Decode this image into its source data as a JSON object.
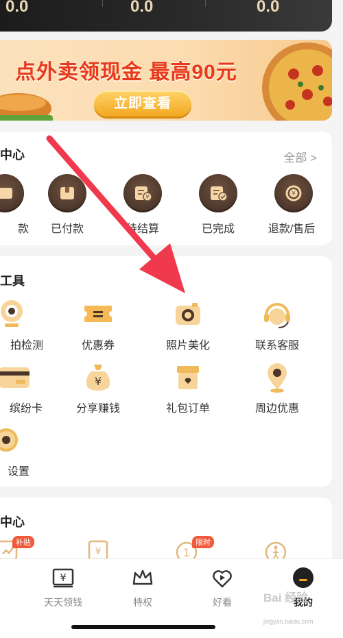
{
  "stats": {
    "values": [
      "0.0",
      "0.0",
      "0.0"
    ]
  },
  "banner": {
    "title": "点外卖领现金 最高90元",
    "cta": "立即查看"
  },
  "orders": {
    "title": "中心",
    "more": "全部 >",
    "items": [
      {
        "label": "款",
        "icon": "wallet-icon"
      },
      {
        "label": "已付款",
        "icon": "package-icon"
      },
      {
        "label": "待结算",
        "icon": "bill-yen-icon"
      },
      {
        "label": "已完成",
        "icon": "bill-check-icon"
      },
      {
        "label": "退款/售后",
        "icon": "refund-icon"
      }
    ]
  },
  "tools": {
    "title": "工具",
    "items": [
      {
        "label": "拍检测",
        "icon": "webcam-icon"
      },
      {
        "label": "优惠券",
        "icon": "coupon-icon"
      },
      {
        "label": "照片美化",
        "icon": "camera-icon"
      },
      {
        "label": "联系客服",
        "icon": "headset-icon"
      },
      {
        "label": "缤纷卡",
        "icon": "card-icon"
      },
      {
        "label": "分享赚钱",
        "icon": "money-bag-icon"
      },
      {
        "label": "礼包订单",
        "icon": "gift-box-icon"
      },
      {
        "label": "周边优惠",
        "icon": "location-pin-icon"
      },
      {
        "label": "设置",
        "icon": "gear-icon"
      }
    ]
  },
  "center2": {
    "title": "中心",
    "badges": [
      "补贴",
      "限时"
    ]
  },
  "tabbar": {
    "items": [
      {
        "label": "天天领钱",
        "icon": "yen-ticket-icon"
      },
      {
        "label": "特权",
        "icon": "crown-icon"
      },
      {
        "label": "好看",
        "icon": "play-heart-icon"
      },
      {
        "label": "我的",
        "icon": "profile-icon",
        "active": true
      }
    ]
  },
  "watermark": {
    "main": "Bai 经验",
    "sub": "jingyan.baidu.com"
  },
  "colors": {
    "accent": "#f2a81f",
    "brown": "#4a3528",
    "arrow": "#f0394d"
  }
}
